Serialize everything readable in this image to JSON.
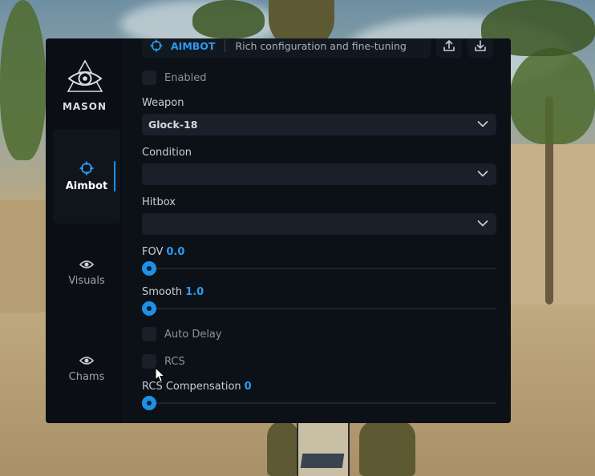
{
  "brand": {
    "name": "MASON"
  },
  "nav": [
    {
      "key": "aimbot",
      "label": "Aimbot",
      "icon": "crosshair-icon",
      "active": true
    },
    {
      "key": "visuals",
      "label": "Visuals",
      "icon": "eye-icon",
      "active": false
    },
    {
      "key": "chams",
      "label": "Chams",
      "icon": "eye-icon",
      "active": false
    }
  ],
  "header": {
    "title": "AIMBOT",
    "subtitle": "Rich configuration and fine-tuning",
    "export_icon": "upload-icon",
    "import_icon": "download-icon"
  },
  "settings": {
    "enabled": {
      "label": "Enabled",
      "checked": false
    },
    "weapon": {
      "label": "Weapon",
      "value": "Glock-18"
    },
    "condition": {
      "label": "Condition",
      "value": ""
    },
    "hitbox": {
      "label": "Hitbox",
      "value": ""
    },
    "fov": {
      "label": "FOV",
      "value": "0.0",
      "fraction": 0
    },
    "smooth": {
      "label": "Smooth",
      "value": "1.0",
      "fraction": 0
    },
    "auto_delay": {
      "label": "Auto Delay",
      "checked": false
    },
    "rcs": {
      "label": "RCS",
      "checked": false
    },
    "rcs_compensation": {
      "label": "RCS Compensation",
      "value": "0",
      "fraction": 0
    }
  },
  "colors": {
    "accent": "#1e90e6",
    "panel": "#0b0f15",
    "control": "#1a2029"
  }
}
